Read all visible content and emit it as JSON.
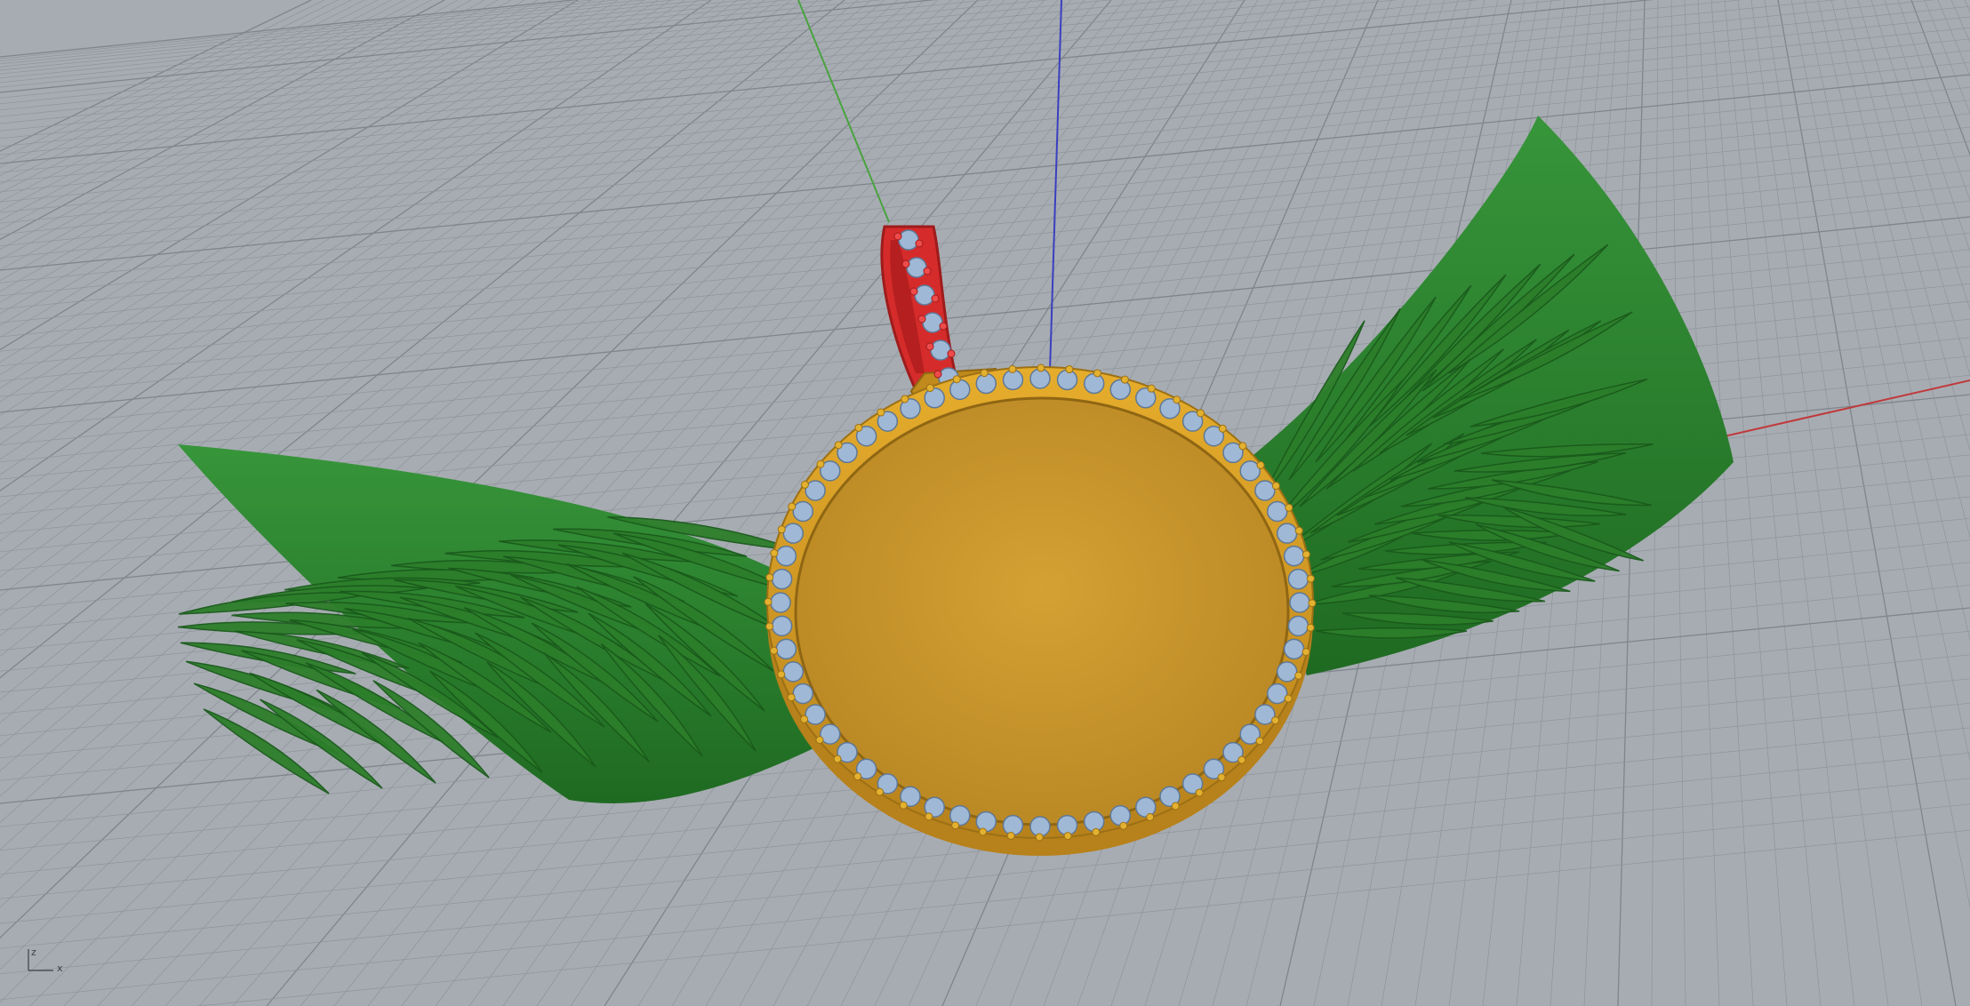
{
  "viewport": {
    "kind": "perspective-3d-view",
    "background_color": "#a7acb2",
    "grid": true,
    "grid_color": "#8e949b",
    "grid_major_color": "#7f858c"
  },
  "world_axes": {
    "x_axis_color": "#c0393b",
    "y_axis_color": "#4aa23f",
    "z_axis_color": "#3a3fc0"
  },
  "model": {
    "name": "winged pendant",
    "parts": {
      "wings": {
        "color": "#2c7e2a"
      },
      "bezel": {
        "color": "#d29a1f",
        "face_color": "#c99427"
      },
      "stones": {
        "color": "#9fb8d6",
        "count": 60
      },
      "bail": {
        "color": "#d62b2b",
        "stone_count": 6
      }
    }
  },
  "axis_gizmo": {
    "x_label": "x",
    "z_label": "z"
  }
}
